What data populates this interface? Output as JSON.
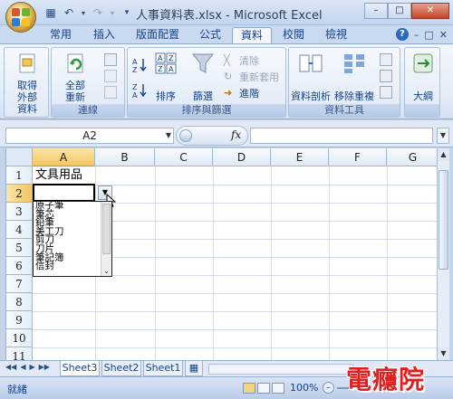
{
  "window": {
    "title": "人事資料表.xlsx - Microsoft Excel",
    "minimize": "–",
    "maximize": "□",
    "close": "✕"
  },
  "tabs": [
    {
      "label": "常用"
    },
    {
      "label": "插入"
    },
    {
      "label": "版面配置"
    },
    {
      "label": "公式"
    },
    {
      "label": "資料"
    },
    {
      "label": "校閱"
    },
    {
      "label": "檢視"
    }
  ],
  "ribbon": {
    "groups": {
      "connections": "連線",
      "sort_filter": "排序與篩選",
      "data_tools": "資料工具",
      "outline": ""
    },
    "get_external_data": "取得外部資料",
    "refresh_all": "全部重新整理",
    "sort": "排序",
    "filter": "篩選",
    "clear": "清除",
    "reapply": "重新套用",
    "advanced": "進階",
    "text_to_columns": "資料剖析",
    "remove_duplicates": "移除重複",
    "outline_btn": "大綱"
  },
  "formula_bar": {
    "name_box": "A2",
    "fx": "fx",
    "content": ""
  },
  "sheet": {
    "columns": [
      "A",
      "B",
      "C",
      "D",
      "E",
      "F",
      "G"
    ],
    "rows": [
      "1",
      "2",
      "3",
      "4",
      "5",
      "6",
      "7",
      "8",
      "9",
      "10",
      "11"
    ],
    "a1": "文具用品"
  },
  "dropdown_items": [
    "原子筆",
    "筆芯",
    "鉛筆",
    "美工刀",
    "剪刀",
    "刀片",
    "筆記簿",
    "信封"
  ],
  "sheet_tabs": [
    "Sheet3",
    "Sheet2",
    "Sheet1"
  ],
  "status": {
    "ready": "就緒",
    "zoom": "100%"
  },
  "watermark": "電癮院",
  "colors": {
    "accent": "#15428b",
    "selected_header": "#f2c560",
    "watermark": "#e02020"
  }
}
